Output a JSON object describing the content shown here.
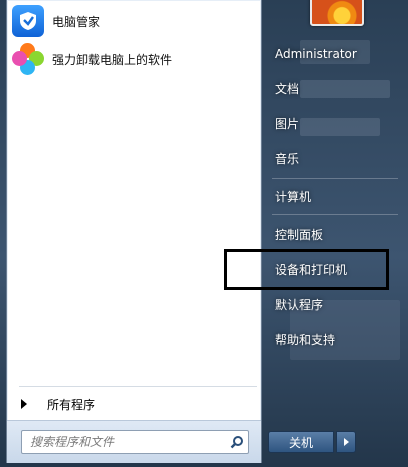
{
  "pinned": [
    {
      "label": "电脑管家",
      "icon": "tencent-pc-manager-icon"
    },
    {
      "label": "强力卸载电脑上的软件",
      "icon": "uninstaller-clover-icon"
    }
  ],
  "all_programs": {
    "label": "所有程序"
  },
  "search": {
    "placeholder": "搜索程序和文件"
  },
  "user": {
    "name": "Administrator"
  },
  "right_items": [
    {
      "label": "文档"
    },
    {
      "label": "图片"
    },
    {
      "label": "音乐"
    },
    {
      "label": "计算机"
    },
    {
      "label": "控制面板"
    },
    {
      "label": "设备和打印机"
    },
    {
      "label": "默认程序"
    },
    {
      "label": "帮助和支持"
    }
  ],
  "shutdown": {
    "label": "关机"
  },
  "colors": {
    "accent": "#1a6fd8",
    "glass": "#3d5570",
    "highlight_box": "#000000"
  }
}
